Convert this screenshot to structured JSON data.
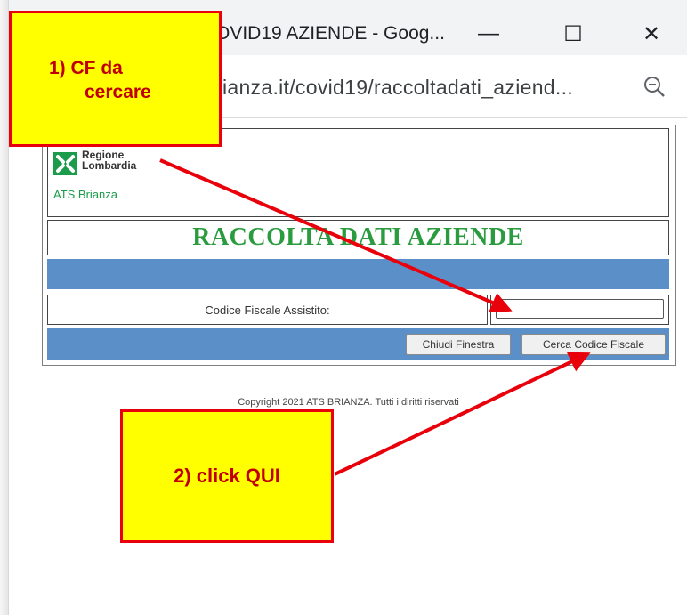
{
  "window": {
    "title": "OVID19 AZIENDE - Goog...",
    "minimize_glyph": "—",
    "maximize_glyph": "☐",
    "close_glyph": "✕",
    "url": "rianza.it/covid19/raccoltadati_aziend...",
    "zoom_icon": "zoom-out-icon"
  },
  "page": {
    "logo_region_line1": "Regione",
    "logo_region_line2": "Lombardia",
    "logo_ats": "ATS Brianza",
    "title": "RACCOLTA DATI AZIENDE",
    "field_label": "Codice Fiscale Assistito:",
    "field_value": "",
    "btn_close": "Chiudi Finestra",
    "btn_search": "Cerca Codice Fiscale",
    "copyright": "Copyright 2021 ATS BRIANZA. Tutti i diritti riservati"
  },
  "annotations": {
    "callout1_line1": "1)  CF da",
    "callout1_line2": "cercare",
    "callout2": "2) click QUI",
    "accent_color": "#e8000b",
    "callout_fill": "#ffff00"
  },
  "colors": {
    "bar_blue": "#5b8fc7",
    "title_green": "#2a9b3e"
  }
}
